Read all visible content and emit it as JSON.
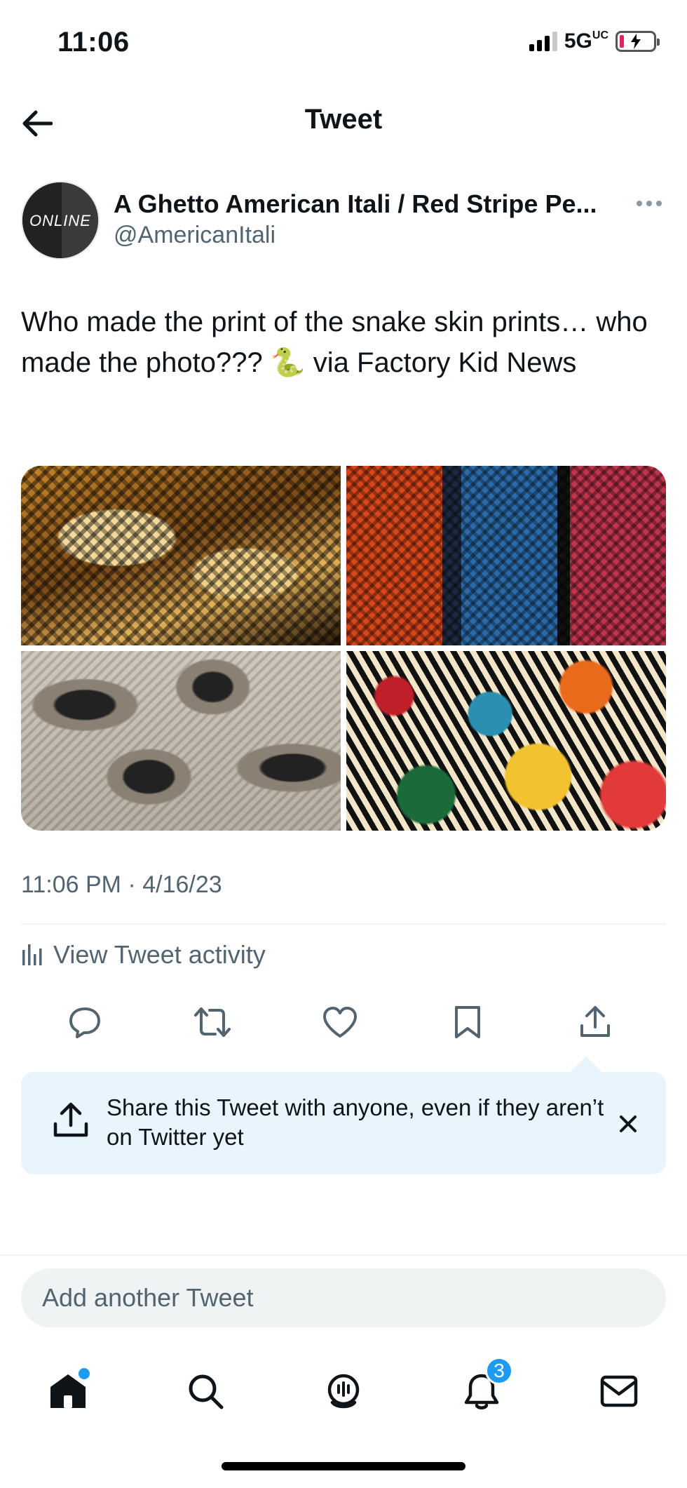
{
  "status_bar": {
    "time": "11:06",
    "network": "5G",
    "network_suffix": "UC",
    "battery_state": "low-charging"
  },
  "header": {
    "title": "Tweet",
    "back_icon": "arrow-left-icon"
  },
  "tweet": {
    "author_name": "A Ghetto American Itali / Red Stripe Pe...",
    "author_handle": "@AmericanItali",
    "avatar_text": "ONLINE",
    "text": "Who made the print of the snake skin prints… who made the photo??? 🐍 via Factory Kid News",
    "timestamp": "11:06 PM · 4/16/23",
    "media": [
      {
        "description": "snake skin print photo 1"
      },
      {
        "description": "snake skin print photo 2"
      },
      {
        "description": "snake skin print photo 3"
      },
      {
        "description": "snake skin print photo 4"
      }
    ]
  },
  "activity": {
    "label": "View Tweet activity"
  },
  "actions": [
    {
      "name": "reply",
      "icon": "reply-icon"
    },
    {
      "name": "retweet",
      "icon": "retweet-icon"
    },
    {
      "name": "like",
      "icon": "heart-icon"
    },
    {
      "name": "bookmark",
      "icon": "bookmark-icon"
    },
    {
      "name": "share",
      "icon": "share-icon"
    }
  ],
  "share_tip": {
    "text": "Share this Tweet with anyone, even if they aren’t on Twitter yet"
  },
  "reply": {
    "placeholder": "Add another Tweet"
  },
  "bottom_nav": {
    "home_dot": true,
    "notifications_count": "3",
    "items": [
      "home-icon",
      "search-icon",
      "spaces-icon",
      "notifications-icon",
      "messages-icon"
    ]
  },
  "colors": {
    "accent": "#1d9bf0",
    "text_secondary": "#536471",
    "tip_background": "#e8f5fd"
  }
}
